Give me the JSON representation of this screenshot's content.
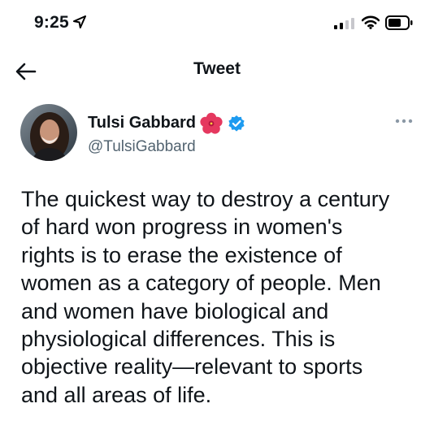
{
  "status_bar": {
    "time": "9:25",
    "location_icon": "location-arrow-icon",
    "signal_icon": "cellular-signal-icon",
    "wifi_icon": "wifi-icon",
    "battery_icon": "battery-icon"
  },
  "nav": {
    "back_icon": "back-arrow-icon",
    "title": "Tweet"
  },
  "author": {
    "name": "Tulsi Gabbard",
    "emoji_icon": "hibiscus-icon",
    "verified_icon": "verified-badge-icon",
    "handle": "@TulsiGabbard",
    "more_icon": "more-options-icon"
  },
  "tweet": {
    "lines": [
      "The quickest way to destroy a century",
      "of hard won progress in women's",
      "rights is to erase the existence of",
      "women as a category of people. Men",
      "and women have biological and",
      "physiological differences. This is",
      "objective reality—relevant to sports",
      "and all areas of life."
    ]
  }
}
